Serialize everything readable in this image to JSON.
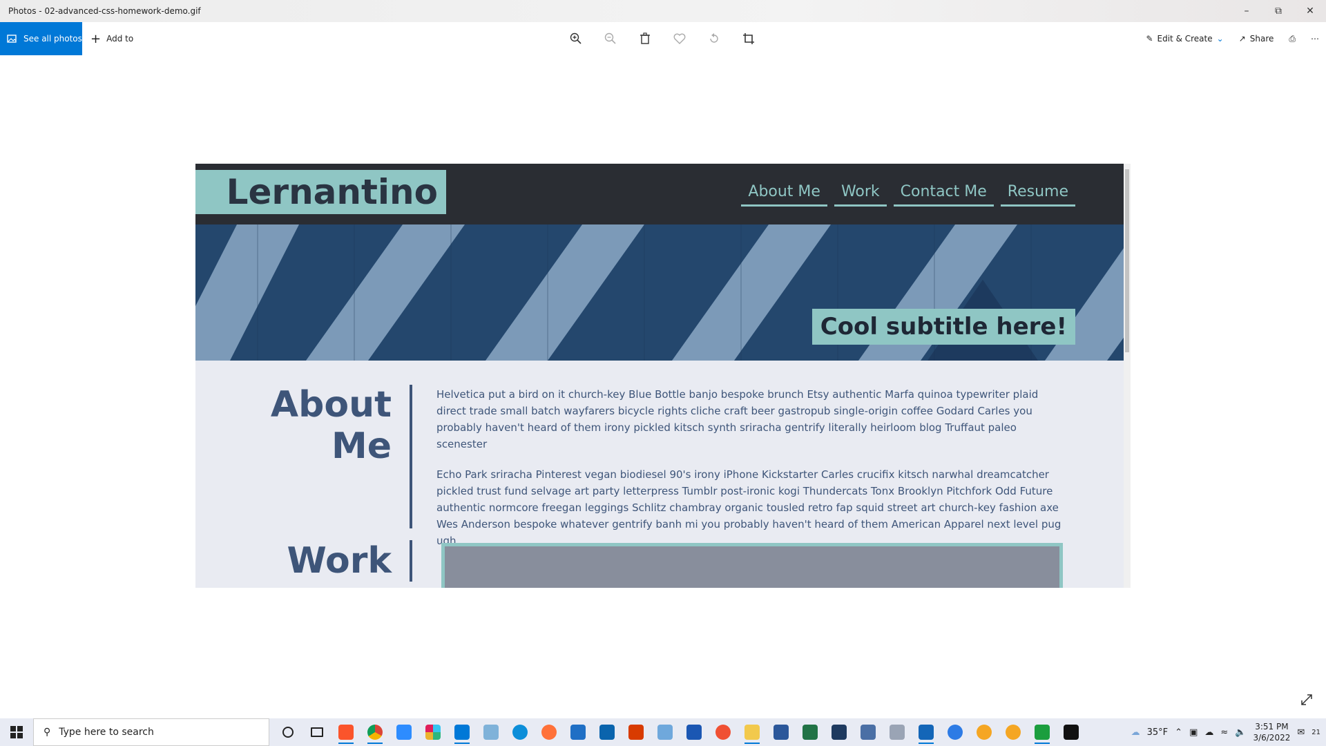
{
  "window": {
    "title": "Photos - 02-advanced-css-homework-demo.gif"
  },
  "toolbar": {
    "see_all_label": "See all photos",
    "add_to_label": "Add to",
    "edit_create_label": "Edit & Create",
    "share_label": "Share"
  },
  "site": {
    "logo": "Lernantino",
    "nav": [
      "About Me",
      "Work",
      "Contact Me",
      "Resume"
    ],
    "hero_subtitle": "Cool subtitle here!",
    "about": {
      "heading_line1": "About",
      "heading_line2": "Me",
      "paragraphs": [
        "Helvetica put a bird on it church-key Blue Bottle banjo bespoke brunch Etsy authentic Marfa quinoa typewriter plaid direct trade small batch wayfarers bicycle rights cliche craft beer gastropub single-origin coffee Godard Carles you probably haven't heard of them irony pickled kitsch synth sriracha gentrify literally heirloom blog Truffaut paleo scenester",
        "Echo Park sriracha Pinterest vegan biodiesel 90's irony iPhone Kickstarter Carles crucifix kitsch narwhal dreamcatcher pickled trust fund selvage art party letterpress Tumblr post-ironic kogi Thundercats Tonx Brooklyn Pitchfork Odd Future authentic normcore freegan leggings Schlitz chambray organic tousled retro fap squid street art church-key fashion axe Wes Anderson bespoke whatever gentrify banh mi you probably haven't heard of them American Apparel next level pug ugh."
      ]
    },
    "work": {
      "heading": "Work"
    }
  },
  "taskbar": {
    "search_placeholder": "Type here to search",
    "weather": "35°F",
    "time": "3:51 PM",
    "date": "3/6/2022",
    "notifications": "21"
  },
  "colors": {
    "accent": "#0078d7",
    "site_teal": "#8fc6c4",
    "site_dark": "#2a2d33",
    "site_text": "#3e5579"
  }
}
